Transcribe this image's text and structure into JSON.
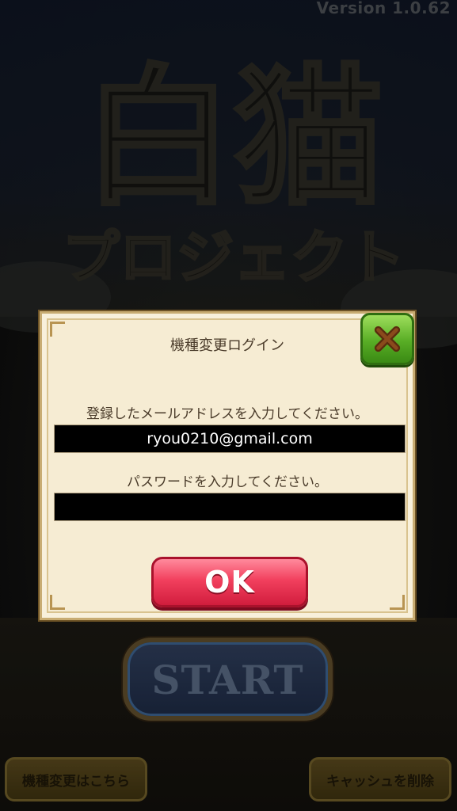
{
  "app": {
    "version": "Version 1.0.62",
    "logo_text": [
      "白猫",
      "プロジェクト"
    ]
  },
  "background": {
    "start_label": "START",
    "bottom_left_label": "機種変更はこちら",
    "bottom_right_label": "キャッシュを削除"
  },
  "dialog": {
    "title": "機種変更ログイン",
    "email_label": "登録したメールアドレスを入力してください。",
    "email_value": "ryou0210@gmail.com",
    "password_label": "パスワードを入力してください。",
    "password_value": "",
    "ok_label": "OK",
    "close_icon": "close-x-icon"
  },
  "colors": {
    "close_button": "#58ad25",
    "ok_button": "#f2405e",
    "dialog_background": "#f6ecd3"
  }
}
